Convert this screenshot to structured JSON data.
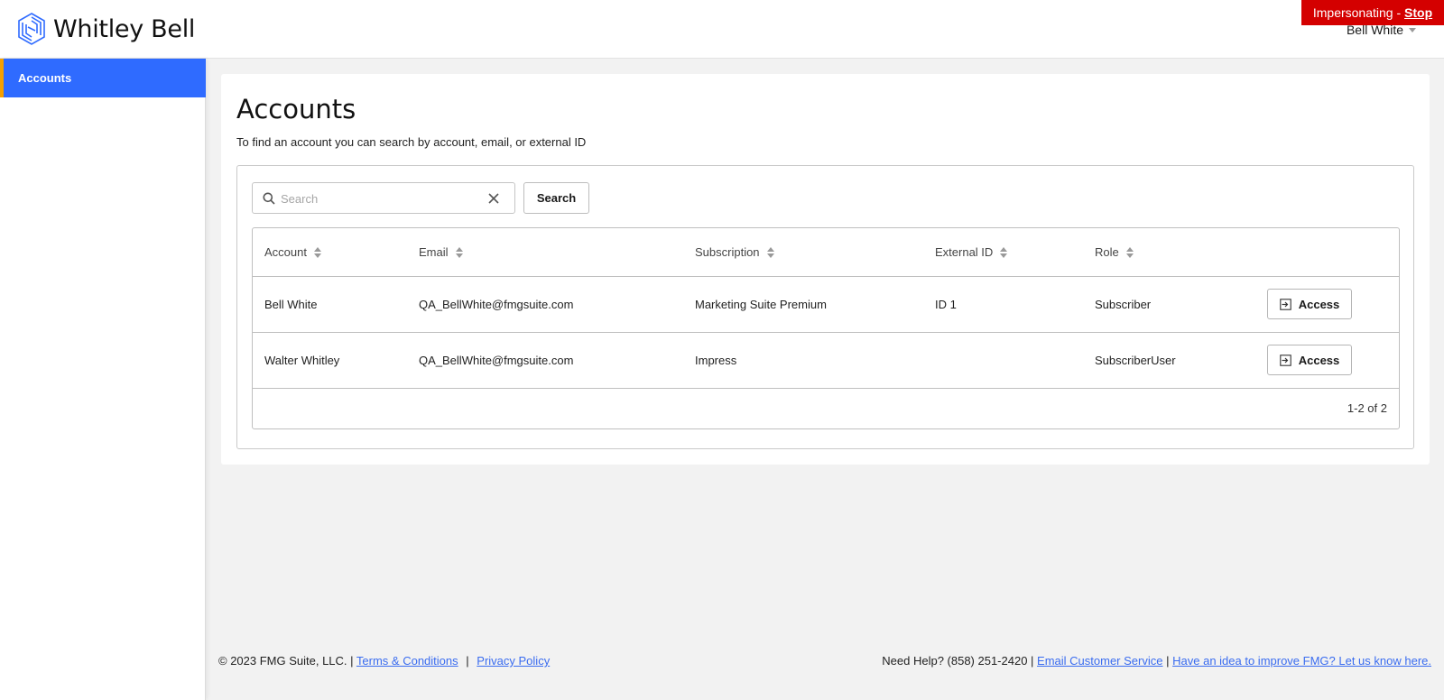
{
  "brand": {
    "name": "Whitley Bell",
    "logo_icon": "hexagon-lines-logo",
    "accent": "#2f6bff"
  },
  "impersonation": {
    "text": "Impersonating - ",
    "stop_label": "Stop",
    "color": "#d40000"
  },
  "user": {
    "name": "Bell White"
  },
  "sidebar": {
    "items": [
      {
        "label": "Accounts",
        "active": true
      }
    ]
  },
  "page": {
    "title": "Accounts",
    "subtitle": "To find an account you can search by account, email, or external ID"
  },
  "search": {
    "placeholder": "Search",
    "value": "",
    "button_label": "Search"
  },
  "table": {
    "columns": [
      "Account",
      "Email",
      "Subscription",
      "External ID",
      "Role"
    ],
    "rows": [
      {
        "account": "Bell White",
        "email": "QA_BellWhite@fmgsuite.com",
        "subscription": "Marketing Suite Premium",
        "external_id": "ID 1",
        "role": "Subscriber",
        "action": "Access"
      },
      {
        "account": "Walter Whitley",
        "email": "QA_BellWhite@fmgsuite.com",
        "subscription": "Impress",
        "external_id": "",
        "role": "SubscriberUser",
        "action": "Access"
      }
    ],
    "pagination": "1-2 of 2"
  },
  "footer": {
    "copyright": "© 2023 FMG Suite, LLC. |",
    "terms": "Terms & Conditions",
    "divider": "|",
    "privacy": "Privacy Policy",
    "help": "Need Help? (858) 251-2420 |",
    "email_service": "Email Customer Service",
    "divider2": "|",
    "improve": "Have an idea to improve FMG? Let us know here."
  }
}
